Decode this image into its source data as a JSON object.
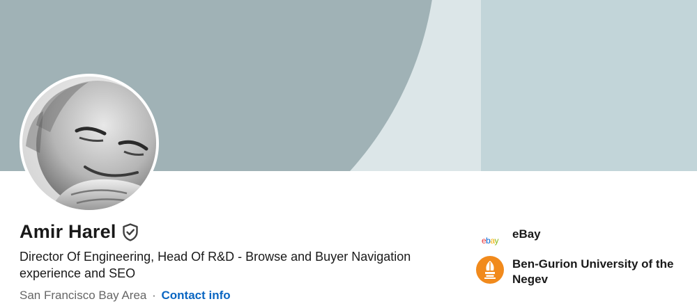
{
  "profile": {
    "name": "Amir Harel",
    "headline": "Director Of Engineering, Head Of R&D - Browse and Buyer Navigation experience and SEO",
    "location": "San Francisco Bay Area",
    "separator": "·",
    "contact_link": "Contact info",
    "verified_icon": "shield-check-icon"
  },
  "sidebar": {
    "items": [
      {
        "label": "eBay",
        "logo_letters": [
          "e",
          "b",
          "a",
          "y"
        ],
        "logo_colors": [
          "#e53238",
          "#0064d2",
          "#f5af02",
          "#86b817"
        ]
      },
      {
        "label": "Ben-Gurion University of the Negev",
        "logo_color": "#f18a1c"
      }
    ]
  },
  "colors": {
    "banner_base": "#dce6e8",
    "banner_circle": "#a0b2b6",
    "banner_right": "#c2d5d9",
    "link": "#0a66c2",
    "secondary_text": "#666666"
  }
}
